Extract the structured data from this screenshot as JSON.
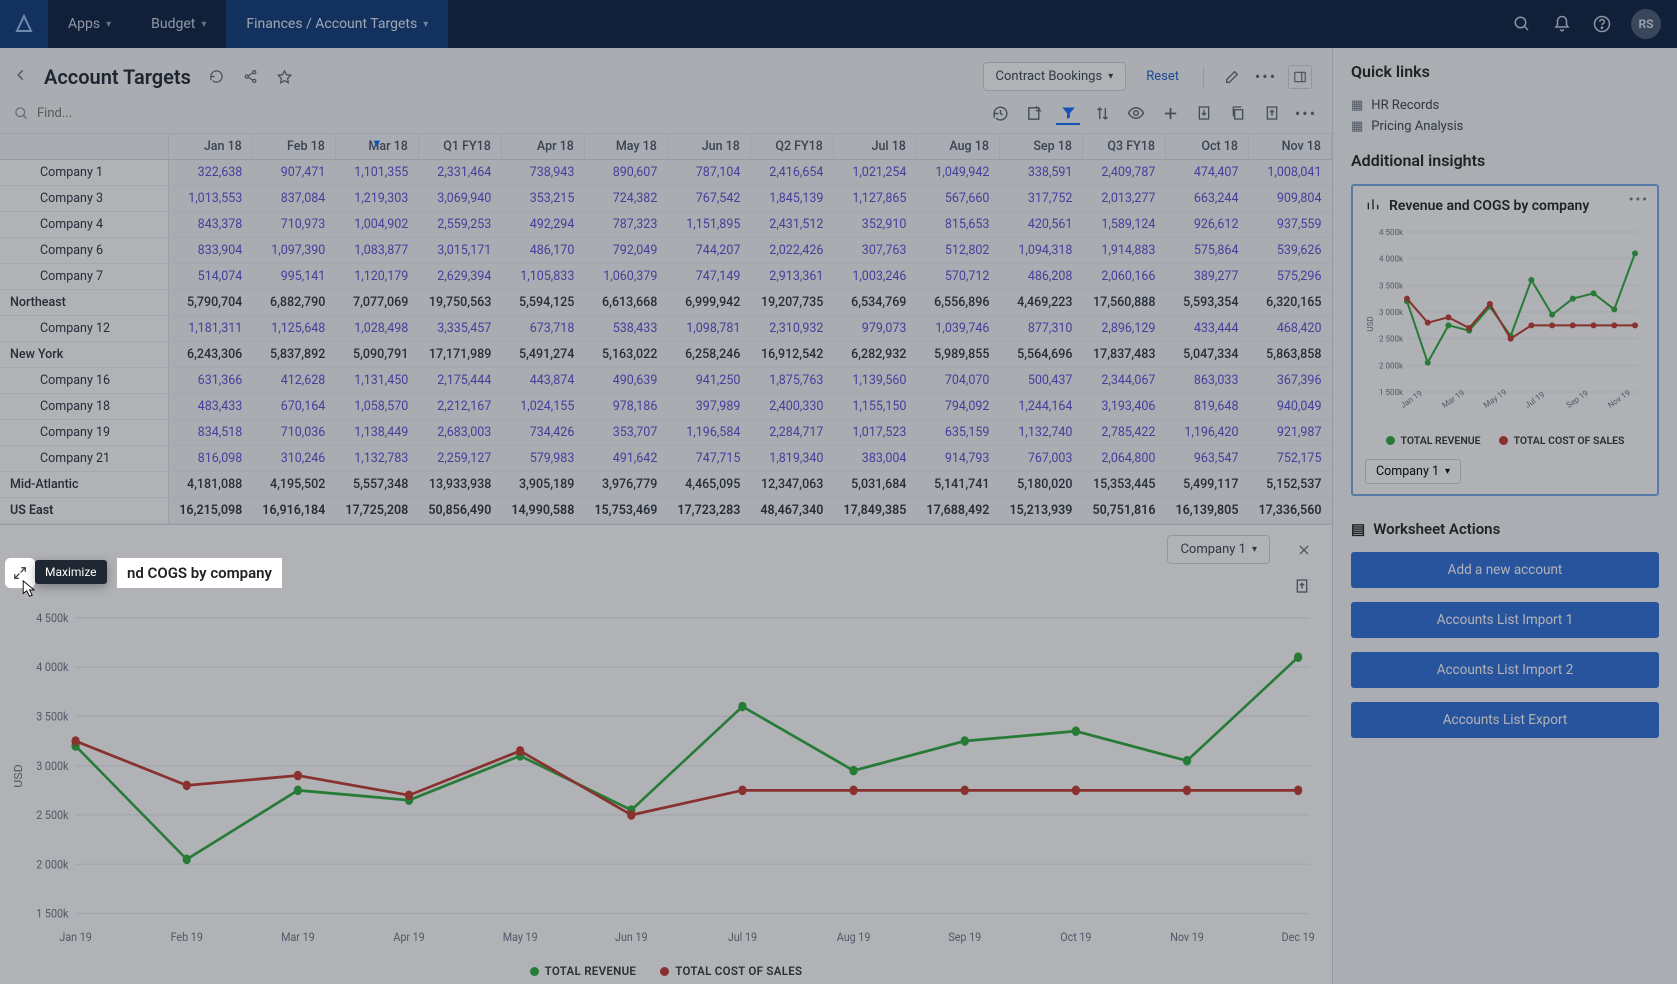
{
  "nav": {
    "apps": "Apps",
    "budget": "Budget",
    "breadcrumb": "Finances / Account Targets",
    "avatar_initials": "RS"
  },
  "titlebar": {
    "title": "Account Targets",
    "contract_pill": "Contract Bookings",
    "reset": "Reset"
  },
  "find_placeholder": "Find...",
  "maximize_tooltip": "Maximize",
  "chart_title_frag": "nd COGS by company",
  "columns": [
    "Jan 18",
    "Feb 18",
    "Mar 18",
    "Q1 FY18",
    "Apr 18",
    "May 18",
    "Jun 18",
    "Q2 FY18",
    "Jul 18",
    "Aug 18",
    "Sep 18",
    "Q3 FY18",
    "Oct 18",
    "Nov 18"
  ],
  "rows": [
    {
      "type": "company",
      "label": "Company 1",
      "v": [
        "322,638",
        "907,471",
        "1,101,355",
        "2,331,464",
        "738,943",
        "890,607",
        "787,104",
        "2,416,654",
        "1,021,254",
        "1,049,942",
        "338,591",
        "2,409,787",
        "474,407",
        "1,008,041"
      ]
    },
    {
      "type": "company",
      "label": "Company 3",
      "v": [
        "1,013,553",
        "837,084",
        "1,219,303",
        "3,069,940",
        "353,215",
        "724,382",
        "767,542",
        "1,845,139",
        "1,127,865",
        "567,660",
        "317,752",
        "2,013,277",
        "663,244",
        "909,804"
      ]
    },
    {
      "type": "company",
      "label": "Company 4",
      "v": [
        "843,378",
        "710,973",
        "1,004,902",
        "2,559,253",
        "492,294",
        "787,323",
        "1,151,895",
        "2,431,512",
        "352,910",
        "815,653",
        "420,561",
        "1,589,124",
        "926,612",
        "937,559"
      ]
    },
    {
      "type": "company",
      "label": "Company 6",
      "v": [
        "833,904",
        "1,097,390",
        "1,083,877",
        "3,015,171",
        "486,170",
        "792,049",
        "744,207",
        "2,022,426",
        "307,763",
        "512,802",
        "1,094,318",
        "1,914,883",
        "575,864",
        "539,626"
      ]
    },
    {
      "type": "company",
      "label": "Company 7",
      "v": [
        "514,074",
        "995,141",
        "1,120,179",
        "2,629,394",
        "1,105,833",
        "1,060,379",
        "747,149",
        "2,913,361",
        "1,003,246",
        "570,712",
        "486,208",
        "2,060,166",
        "389,277",
        "575,296"
      ]
    },
    {
      "type": "region",
      "label": "Northeast",
      "v": [
        "5,790,704",
        "6,882,790",
        "7,077,069",
        "19,750,563",
        "5,594,125",
        "6,613,668",
        "6,999,942",
        "19,207,735",
        "6,534,769",
        "6,556,896",
        "4,469,223",
        "17,560,888",
        "5,593,354",
        "6,320,165"
      ]
    },
    {
      "type": "company",
      "label": "Company 12",
      "v": [
        "1,181,311",
        "1,125,648",
        "1,028,498",
        "3,335,457",
        "673,718",
        "538,433",
        "1,098,781",
        "2,310,932",
        "979,073",
        "1,039,746",
        "877,310",
        "2,896,129",
        "433,444",
        "468,420"
      ]
    },
    {
      "type": "region",
      "label": "New York",
      "v": [
        "6,243,306",
        "5,837,892",
        "5,090,791",
        "17,171,989",
        "5,491,274",
        "5,163,022",
        "6,258,246",
        "16,912,542",
        "6,282,932",
        "5,989,855",
        "5,564,696",
        "17,837,483",
        "5,047,334",
        "5,863,858"
      ]
    },
    {
      "type": "company",
      "label": "Company 16",
      "v": [
        "631,366",
        "412,628",
        "1,131,450",
        "2,175,444",
        "443,874",
        "490,639",
        "941,250",
        "1,875,763",
        "1,139,560",
        "704,070",
        "500,437",
        "2,344,067",
        "863,033",
        "367,396"
      ]
    },
    {
      "type": "company",
      "label": "Company 18",
      "v": [
        "483,433",
        "670,164",
        "1,058,570",
        "2,212,167",
        "1,024,155",
        "978,186",
        "397,989",
        "2,400,330",
        "1,155,150",
        "794,092",
        "1,244,164",
        "3,193,406",
        "819,648",
        "940,049"
      ]
    },
    {
      "type": "company",
      "label": "Company 19",
      "v": [
        "834,518",
        "710,036",
        "1,138,449",
        "2,683,003",
        "734,426",
        "353,707",
        "1,196,584",
        "2,284,717",
        "1,017,523",
        "635,159",
        "1,132,740",
        "2,785,422",
        "1,196,420",
        "921,987"
      ]
    },
    {
      "type": "company",
      "label": "Company 21",
      "v": [
        "816,098",
        "310,246",
        "1,132,783",
        "2,259,127",
        "579,983",
        "491,642",
        "747,715",
        "1,819,340",
        "383,004",
        "914,793",
        "767,003",
        "2,064,800",
        "963,547",
        "752,175"
      ]
    },
    {
      "type": "region",
      "label": "Mid-Atlantic",
      "v": [
        "4,181,088",
        "4,195,502",
        "5,557,348",
        "13,933,938",
        "3,905,189",
        "3,976,779",
        "4,465,095",
        "12,347,063",
        "5,031,684",
        "5,141,741",
        "5,180,020",
        "15,353,445",
        "5,499,117",
        "5,152,537"
      ]
    },
    {
      "type": "total",
      "label": "US East",
      "v": [
        "16,215,098",
        "16,916,184",
        "17,725,208",
        "50,856,490",
        "14,990,588",
        "15,753,469",
        "17,723,283",
        "48,467,340",
        "17,849,385",
        "17,688,492",
        "15,213,939",
        "50,751,816",
        "16,139,805",
        "17,336,560"
      ]
    }
  ],
  "chart": {
    "company_filter": "Company 1",
    "legend_rev": "TOTAL REVENUE",
    "legend_cogs": "TOTAL COST OF SALES"
  },
  "chart_data": {
    "type": "line",
    "x": [
      "Jan 19",
      "Feb 19",
      "Mar 19",
      "Apr 19",
      "May 19",
      "Jun 19",
      "Jul 19",
      "Aug 19",
      "Sep 19",
      "Oct 19",
      "Nov 19",
      "Dec 19"
    ],
    "series": [
      {
        "name": "TOTAL REVENUE",
        "color": "#2eaa3c",
        "values": [
          3200000,
          2050000,
          2750000,
          2650000,
          3100000,
          2550000,
          3600000,
          2950000,
          3250000,
          3350000,
          3050000,
          4100000
        ]
      },
      {
        "name": "TOTAL COST OF SALES",
        "color": "#c23a2e",
        "values": [
          3250000,
          2800000,
          2900000,
          2700000,
          3150000,
          2500000,
          2750000,
          2750000,
          2750000,
          2750000,
          2750000,
          2750000
        ]
      }
    ],
    "ylabel": "USD",
    "yticks": [
      "1 500k",
      "2 000k",
      "2 500k",
      "3 000k",
      "3 500k",
      "4 000k",
      "4 500k"
    ],
    "ylim": [
      1500000,
      4500000
    ]
  },
  "mini_chart_data": {
    "type": "line",
    "x": [
      "Jan 19",
      "Mar 19",
      "May 19",
      "Jul 19",
      "Sep 19",
      "Nov 19"
    ],
    "yticks": [
      "1 500k",
      "2 000k",
      "2 500k",
      "3 000k",
      "3 500k",
      "4 000k",
      "4 500k"
    ],
    "ylabel": "USD",
    "series": [
      {
        "name": "TOTAL REVENUE",
        "color": "#2eaa3c",
        "values": [
          3200,
          2050,
          2750,
          2650,
          3100,
          2550,
          3600,
          2950,
          3250,
          3350,
          3050,
          4100
        ]
      },
      {
        "name": "TOTAL COST OF SALES",
        "color": "#c23a2e",
        "values": [
          3250,
          2800,
          2900,
          2700,
          3150,
          2500,
          2750,
          2750,
          2750,
          2750,
          2750,
          2750
        ]
      }
    ]
  },
  "sidepanel": {
    "quick_links_h": "Quick links",
    "link_hr": "HR Records",
    "link_pricing": "Pricing Analysis",
    "insights_h": "Additional insights",
    "insight_title": "Revenue and COGS by company",
    "insight_filter": "Company 1",
    "ws_actions_h": "Worksheet Actions",
    "btn_add": "Add a new account",
    "btn_imp1": "Accounts List Import 1",
    "btn_imp2": "Accounts List Import 2",
    "btn_exp": "Accounts List Export"
  }
}
